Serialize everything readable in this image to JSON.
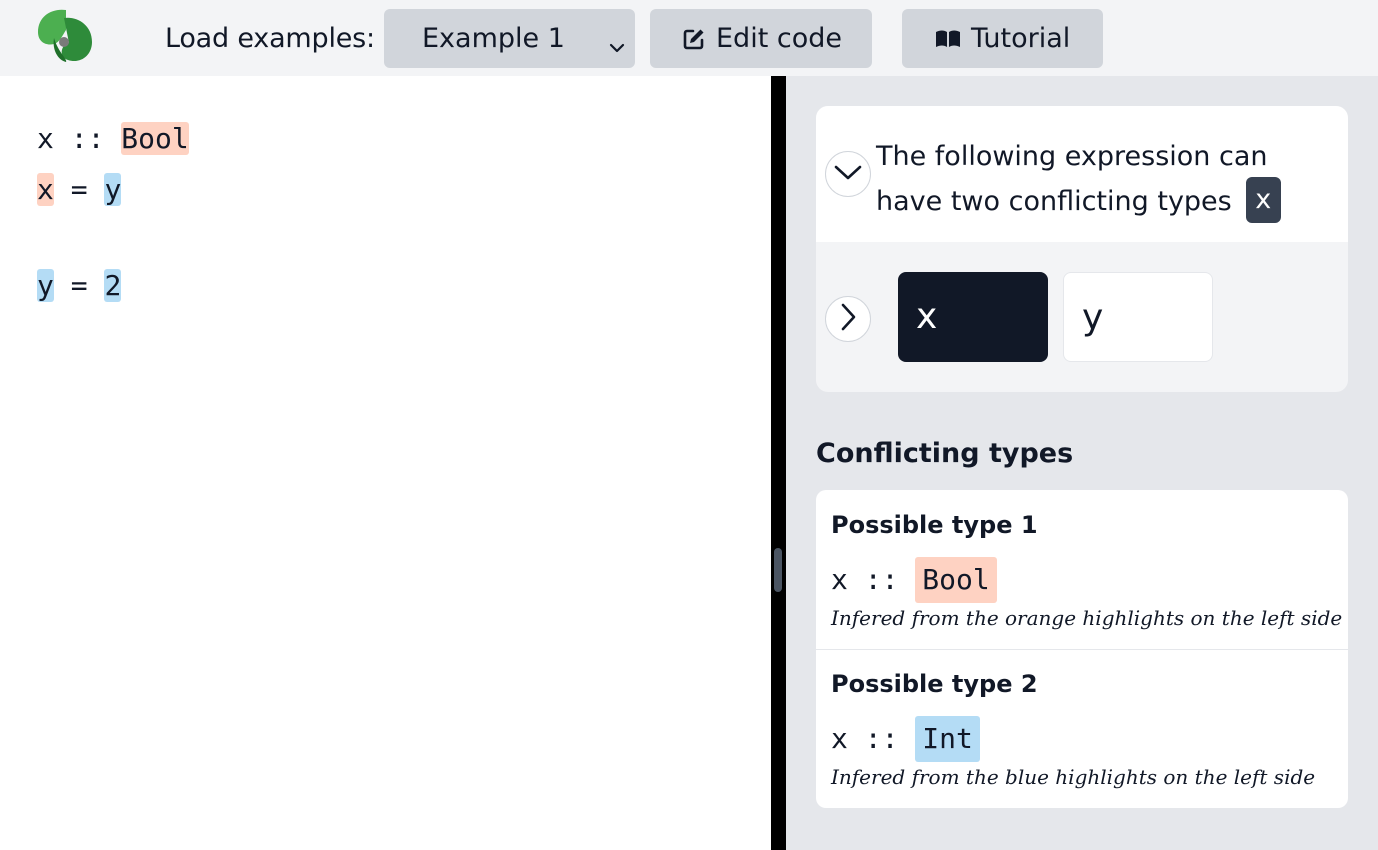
{
  "topbar": {
    "load_label": "Load examples:",
    "example_select": {
      "selected": "Example 1"
    },
    "edit_label": "Edit code",
    "tutorial_label": "Tutorial"
  },
  "editor": {
    "lines": [
      [
        {
          "text": "x :: ",
          "hl": ""
        },
        {
          "text": "Bool",
          "hl": "orange"
        }
      ],
      [
        {
          "text": "x",
          "hl": "orange"
        },
        {
          "text": " = ",
          "hl": ""
        },
        {
          "text": "y",
          "hl": "blue"
        }
      ],
      [
        {
          "text": "y",
          "hl": "blue"
        },
        {
          "text": " = ",
          "hl": ""
        },
        {
          "text": "2",
          "hl": "blue"
        }
      ]
    ]
  },
  "panel": {
    "message": "The following expression can have two conflicting types",
    "expression": "x",
    "chips": [
      "x",
      "y"
    ],
    "conflicting_title": "Conflicting types",
    "types": [
      {
        "title": "Possible type 1",
        "var": "x",
        "sep": "::",
        "type": "Bool",
        "note": "Infered from the orange highlights on the left side"
      },
      {
        "title": "Possible type 2",
        "var": "x",
        "sep": "::",
        "type": "Int",
        "note": "Infered from the blue highlights on the left side"
      }
    ]
  },
  "colors": {
    "orange_highlight": "#fed2c2",
    "blue_highlight": "#b4dcf5",
    "topbar_bg": "#f3f4f6",
    "button_bg": "#d1d5db",
    "panel_bg": "#e5e7eb",
    "dark_chip": "#111827"
  },
  "icons": {
    "logo": "green-chameleon-logo",
    "select_chevron": "chevron-down-icon",
    "edit": "edit-icon",
    "tutorial": "book-icon",
    "collapse": "chevron-down-icon",
    "expand": "chevron-right-icon"
  }
}
